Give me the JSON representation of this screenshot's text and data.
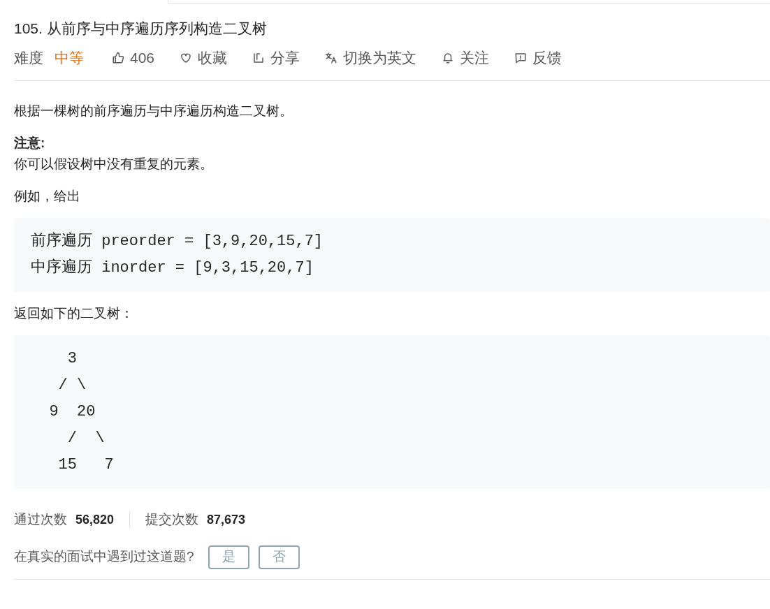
{
  "title": "105. 从前序与中序遍历序列构造二叉树",
  "difficulty": {
    "label": "难度",
    "value": "中等"
  },
  "actions": [
    {
      "kind": "like",
      "label": "406"
    },
    {
      "kind": "favorite",
      "label": "收藏"
    },
    {
      "kind": "share",
      "label": "分享"
    },
    {
      "kind": "translate",
      "label": "切换为英文"
    },
    {
      "kind": "follow",
      "label": "关注"
    },
    {
      "kind": "feedback",
      "label": "反馈"
    }
  ],
  "content": [
    {
      "kind": "paragraph",
      "text": "根据一棵树的前序遍历与中序遍历构造二叉树。"
    },
    {
      "kind": "note",
      "heading": "注意:",
      "text": "你可以假设树中没有重复的元素。"
    },
    {
      "kind": "paragraph",
      "text": "例如，给出"
    },
    {
      "kind": "code",
      "lines": [
        "前序遍历 preorder = [3,9,20,15,7]",
        "中序遍历 inorder = [9,3,15,20,7]"
      ]
    },
    {
      "kind": "paragraph",
      "text": "返回如下的二叉树："
    },
    {
      "kind": "code",
      "lines": [
        "    3",
        "   / \\",
        "  9  20",
        "    /  \\",
        "   15   7"
      ]
    }
  ],
  "stats": [
    {
      "label": "通过次数",
      "value": "56,820"
    },
    {
      "label": "提交次数",
      "value": "87,673"
    }
  ],
  "interview": {
    "question": "在真实的面试中遇到过这道题?",
    "buttons": [
      "是",
      "否"
    ]
  }
}
